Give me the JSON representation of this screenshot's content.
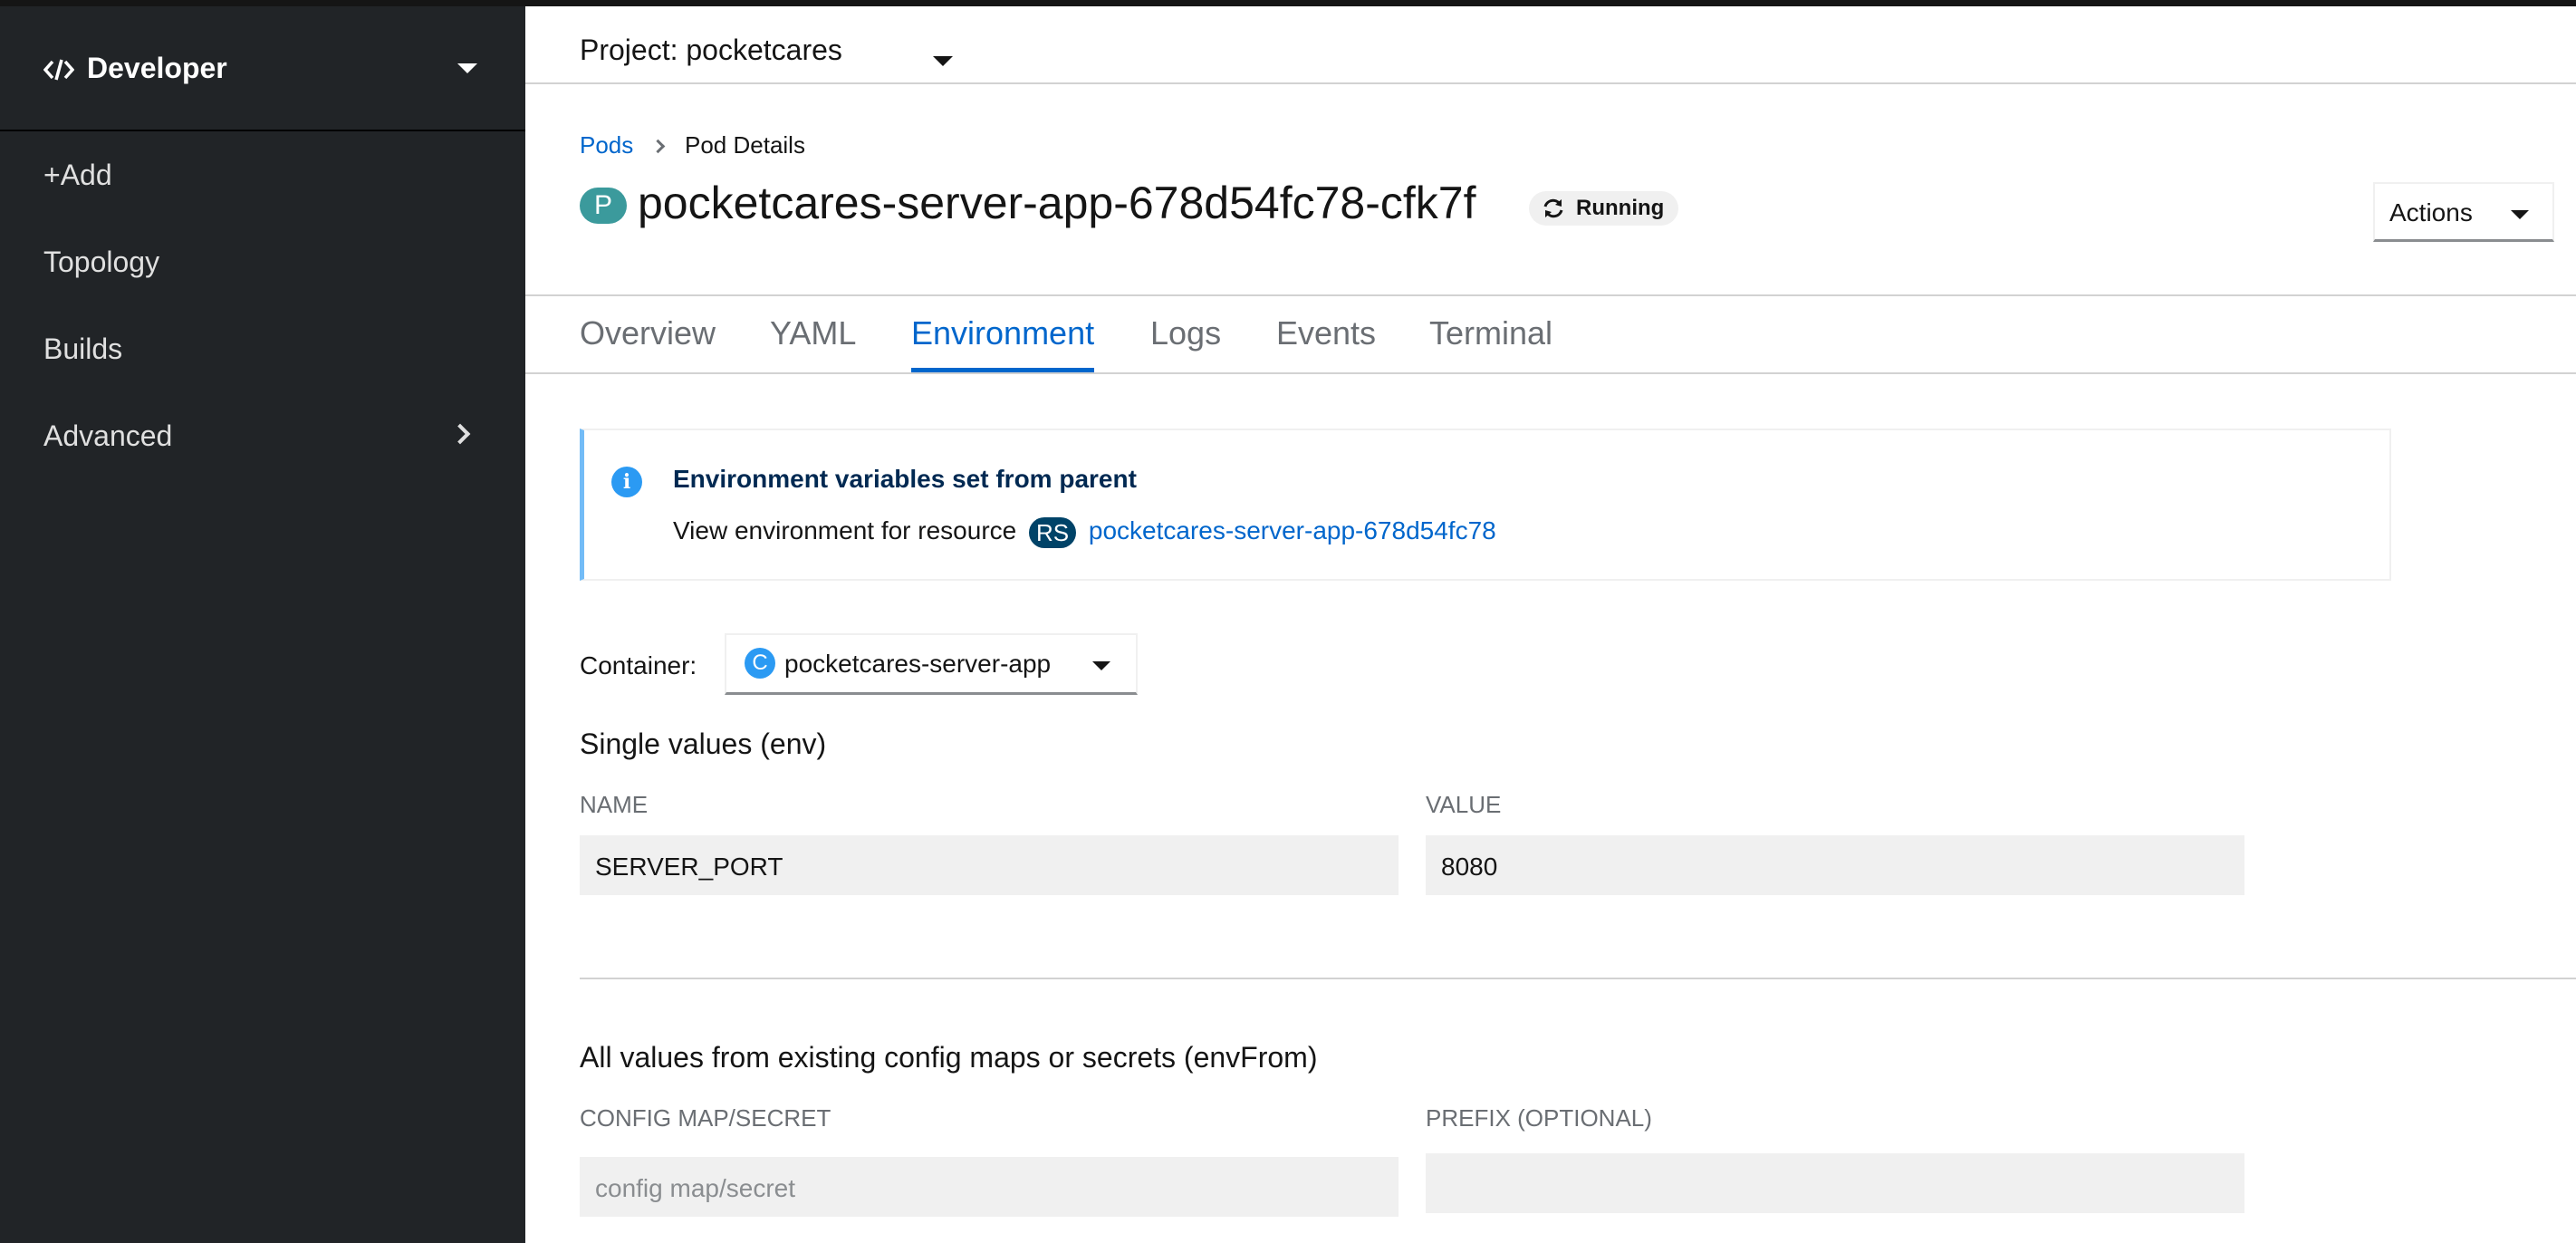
{
  "sidebar": {
    "perspective": {
      "label": "Developer",
      "icon": "code-icon"
    },
    "items": [
      {
        "label": "+Add"
      },
      {
        "label": "Topology"
      },
      {
        "label": "Builds"
      },
      {
        "label": "Advanced",
        "icon": "chevron-right-icon"
      }
    ]
  },
  "project": {
    "label": "Project: pocketcares"
  },
  "breadcrumb": {
    "parent": "Pods",
    "current": "Pod Details"
  },
  "pod": {
    "badge": "P",
    "name": "pocketcares-server-app-678d54fc78-cfk7f",
    "status": "Running"
  },
  "actions": {
    "label": "Actions"
  },
  "tabs": [
    {
      "label": "Overview"
    },
    {
      "label": "YAML"
    },
    {
      "label": "Environment",
      "active": true
    },
    {
      "label": "Logs"
    },
    {
      "label": "Events"
    },
    {
      "label": "Terminal"
    }
  ],
  "alert": {
    "title": "Environment variables set from parent",
    "body": "View environment for resource",
    "badge": "RS",
    "link": "pocketcares-server-app-678d54fc78"
  },
  "container": {
    "label": "Container:",
    "badge": "C",
    "value": "pocketcares-server-app"
  },
  "env": {
    "title": "Single values (env)",
    "name_header": "NAME",
    "value_header": "VALUE",
    "rows": [
      {
        "name": "SERVER_PORT",
        "value": "8080"
      }
    ]
  },
  "envFrom": {
    "title": "All values from existing config maps or secrets (envFrom)",
    "source_header": "CONFIG MAP/SECRET",
    "prefix_header": "PREFIX (OPTIONAL)",
    "source_placeholder": "config map/secret",
    "prefix_value": ""
  },
  "colors": {
    "sidebar_bg": "#212427",
    "link": "#0066cc",
    "alert_border": "#73bcf7",
    "alert_title": "#002952",
    "field_bg": "#f0f0f0"
  }
}
